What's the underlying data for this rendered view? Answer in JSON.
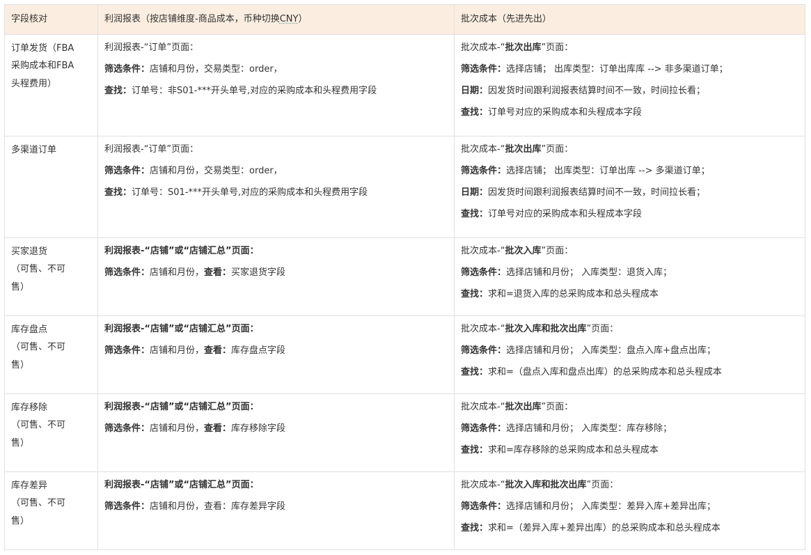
{
  "header": {
    "col1": "字段核对",
    "col2_pre": "利润报表（按店铺维度-商品成本，币种切换",
    "col2_cny": "CNY",
    "col2_post": "）",
    "col3": "批次成本（先进先出）"
  },
  "rows": [
    {
      "field_lines": [
        "订单发货（FBA",
        "采购成本和FBA",
        "头程费用）"
      ],
      "profit": {
        "title_pre": "利润报表-“订单”页面：",
        "filter_label": "筛选条件：",
        "filter_text": "店铺和月份，交易类型：order，",
        "find_label": "查找：",
        "find_text": "订单号：非S01-***开头单号,对应的采购成本和头程费用字段"
      },
      "batch": {
        "title_pre": "批次成本-“",
        "title_bold": "批次出库",
        "title_post": "”页面：",
        "filter_label": "筛选条件：",
        "filter_text": "选择店铺；  出库类型：订单出库库 --> 非多渠道订单；",
        "date_label": "日期：",
        "date_text": "因发货时间跟利润报表结算时间不一致，时间拉长看；",
        "find_label": "查找：",
        "find_text": "订单号对应的采购成本和头程成本字段"
      }
    },
    {
      "field_lines": [
        "多渠道订单"
      ],
      "profit": {
        "title_pre": "利润报表-“订单”页面：",
        "filter_label": "筛选条件：",
        "filter_text": "店铺和月份，交易类型：order，",
        "find_label": "查找：",
        "find_text": "订单号：S01-***开头单号,对应的采购成本和头程费用字段"
      },
      "batch": {
        "title_pre": "批次成本-“",
        "title_bold": "批次出库",
        "title_post": "”页面：",
        "filter_label": "筛选条件：",
        "filter_text": "选择店铺；  出库类型：订单出库 --> 多渠道订单；",
        "date_label": "日期：",
        "date_text": "因发货时间跟利润报表结算时间不一致，时间拉长看；",
        "find_label": "查找：",
        "find_text": "订单号对应的采购成本和头程成本字段"
      }
    },
    {
      "field_lines": [
        "买家退货",
        "（可售、不可",
        "售）"
      ],
      "profit": {
        "title_bold": "利润报表-“店铺”或“店铺汇总”页面：",
        "filter_label": "筛选条件：",
        "filter_text": "店铺和月份，",
        "view_label": "查看：",
        "view_text": "买家退货字段"
      },
      "batch": {
        "title_pre": "批次成本-“",
        "title_bold": "批次入库",
        "title_post": "”页面：",
        "filter_label": "筛选条件：",
        "filter_text": "选择店铺和月份；  入库类型：退货入库；",
        "find_label": "查找：",
        "find_text": "求和=退货入库的总采购成本和总头程成本"
      }
    },
    {
      "field_lines": [
        "库存盘点",
        "（可售、不可",
        "售）"
      ],
      "profit": {
        "title_bold": "利润报表-“店铺”或“店铺汇总”页面：",
        "filter_label": "筛选条件：",
        "filter_text": "店铺和月份，",
        "view_label": "查看：",
        "view_text": "库存盘点字段"
      },
      "batch": {
        "title_pre": "批次成本-“",
        "title_bold": "批次入库和批次出库",
        "title_post": "”页面：",
        "filter_label": "筛选条件：",
        "filter_text": "选择店铺和月份；  入库类型：盘点入库+盘点出库；",
        "find_label": "查找：",
        "find_text": "求和=（盘点入库和盘点出库）的总采购成本和总头程成本"
      }
    },
    {
      "field_lines": [
        "库存移除",
        "（可售、不可",
        "售）"
      ],
      "profit": {
        "title_bold": "利润报表-“店铺”或“店铺汇总”页面：",
        "filter_label": "筛选条件：",
        "filter_text": "店铺和月份，",
        "view_label": "查看：",
        "view_text": "库存移除字段"
      },
      "batch": {
        "title_pre": "批次成本-“",
        "title_bold": "批次出库",
        "title_post": "”页面：",
        "filter_label": "筛选条件：",
        "filter_text": "选择店铺和月份；  入库类型：库存移除；",
        "find_label": "查找：",
        "find_text": "求和=库存移除的总采购成本和总头程成本"
      }
    },
    {
      "field_lines": [
        "库存差异",
        "（可售、不可",
        "售）"
      ],
      "profit": {
        "title_bold": "利润报表-“店铺”或“店铺汇总”页面：",
        "filter_label": "筛选条件：",
        "filter_text": "店铺和月份，查看：库存差异字段"
      },
      "batch": {
        "title_pre": "批次成本-“",
        "title_bold": "批次入库和批次出库",
        "title_post": "”页面：",
        "filter_label": "筛选条件：",
        "filter_text": "选择店铺和月份；  入库类型：差异入库+差异出库；",
        "find_label": "查找：",
        "find_text": "求和=（差异入库+差异出库）的总采购成本和总头程成本"
      }
    }
  ]
}
